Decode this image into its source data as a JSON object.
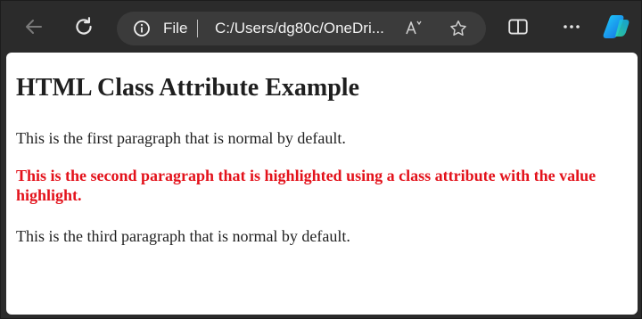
{
  "browser": {
    "address_bar": {
      "scheme_label": "File",
      "url": "C:/Users/dg80c/OneDri..."
    },
    "icons": {
      "back": "back-arrow-icon",
      "reload": "reload-icon",
      "info": "info-icon",
      "read_aloud": "read-aloud-icon",
      "favorite": "star-icon",
      "split_screen": "split-screen-icon",
      "more": "more-dots-icon",
      "copilot": "copilot-icon"
    }
  },
  "page": {
    "heading": "HTML Class Attribute Example",
    "paragraphs": [
      "This is the first paragraph that is normal by default.",
      "This is the second paragraph that is highlighted using a class attribute with the value highlight.",
      "This is the third paragraph that is normal by default."
    ],
    "highlight_color": "#e3121b"
  }
}
